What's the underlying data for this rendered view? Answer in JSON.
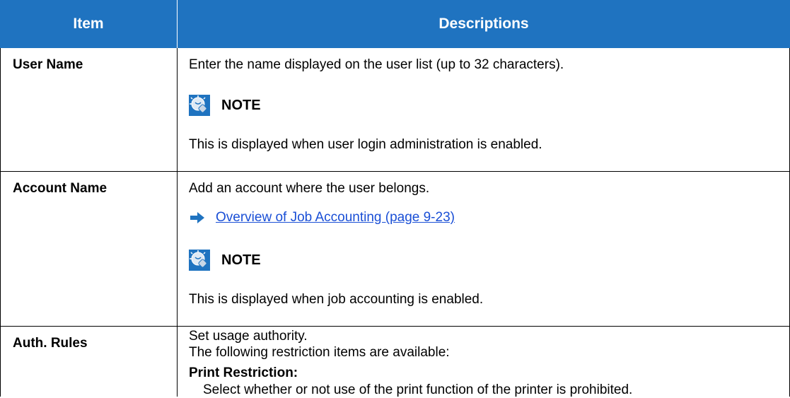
{
  "table": {
    "headers": {
      "item": "Item",
      "descriptions": "Descriptions"
    },
    "rows": [
      {
        "item": "User Name",
        "description": "Enter the name displayed on the user list (up to 32 characters).",
        "note_label": "NOTE",
        "note_text": "This is displayed when user login administration is enabled."
      },
      {
        "item": "Account Name",
        "description": "Add an account where the user belongs.",
        "link_text": "Overview of Job Accounting (page 9-23)",
        "note_label": "NOTE",
        "note_text": "This is displayed when job accounting is enabled."
      },
      {
        "item": "Auth. Rules",
        "description_line1": "Set usage authority.",
        "description_line2": "The following restriction items are available:",
        "subheading": "Print Restriction:",
        "subtext": "Select whether or not use of the print function of the printer is prohibited."
      }
    ]
  },
  "colors": {
    "header_bg": "#1f73c0",
    "link": "#1a4fd6",
    "icon_blue": "#1f73c0"
  },
  "icons": {
    "note": "lightbulb-note-icon",
    "link_arrow": "right-arrow-icon"
  }
}
